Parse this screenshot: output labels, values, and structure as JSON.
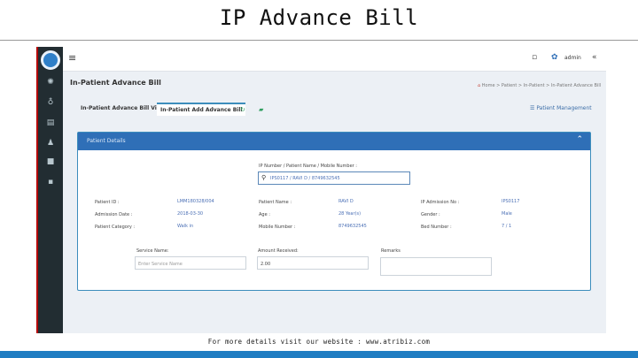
{
  "slide": {
    "title": "IP Advance Bill",
    "footer": "For more details visit our website : www.atribiz.com"
  },
  "colors": {
    "accent": "#2f6fb7",
    "sidebar": "#222d32",
    "bottom_bar": "#1f7dc2"
  },
  "topbar": {
    "user": "admin",
    "icons": [
      "menu-icon",
      "notification-icon",
      "settings-icon",
      "user-icon",
      "expand-icon"
    ]
  },
  "page": {
    "title": "In-Patient Advance Bill",
    "breadcrumb": [
      "Home",
      "Patient",
      "In-Patient",
      "In-Patient Advance Bill"
    ]
  },
  "tabs": [
    {
      "label": "In-Patient Advance Bill View"
    },
    {
      "label": "In-Patient Add Advance Bill"
    }
  ],
  "patient_management_link": "Patient Management",
  "panel": {
    "title": "Patient Details",
    "search_label": "IP Number / Patient Name / Mobile Number :",
    "search_value": "IPS0117 / RAVI D / 8749632545",
    "details": [
      {
        "label": "Patient ID :",
        "value": "LMM180328/004"
      },
      {
        "label": "Patient Name :",
        "value": "RAVI D"
      },
      {
        "label": "IP Admission No :",
        "value": "IPS0117"
      },
      {
        "label": "Admission Date :",
        "value": "2018-03-30"
      },
      {
        "label": "Age :",
        "value": "28 Year(s)"
      },
      {
        "label": "Gender :",
        "value": "Male"
      },
      {
        "label": "Patient Category :",
        "value": "Walk in"
      },
      {
        "label": "Mobile Number :",
        "value": "8749632545"
      },
      {
        "label": "Bed Number :",
        "value": "7 / 1"
      }
    ],
    "service_name": {
      "label": "Service Name:",
      "placeholder": "Enter Service Name"
    },
    "amount_received": {
      "label": "Amount Received:",
      "value": "2.00"
    },
    "remarks": {
      "label": "Remarks"
    }
  }
}
